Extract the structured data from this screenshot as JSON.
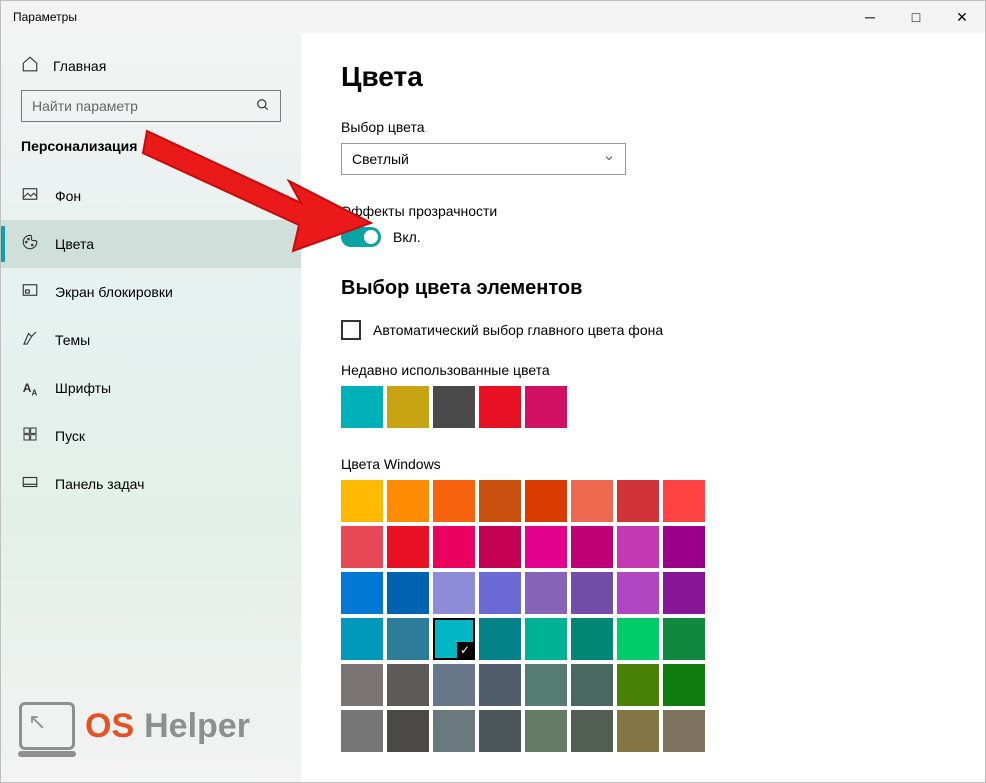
{
  "titlebar": {
    "app_title": "Параметры"
  },
  "sidebar": {
    "home_label": "Главная",
    "search_placeholder": "Найти параметр",
    "category": "Персонализация",
    "items": [
      {
        "label": "Фон"
      },
      {
        "label": "Цвета"
      },
      {
        "label": "Экран блокировки"
      },
      {
        "label": "Темы"
      },
      {
        "label": "Шрифты"
      },
      {
        "label": "Пуск"
      },
      {
        "label": "Панель задач"
      }
    ]
  },
  "page": {
    "title": "Цвета",
    "color_mode_label": "Выбор цвета",
    "color_mode_value": "Светлый",
    "transparency_label": "Эффекты прозрачности",
    "transparency_state": "Вкл.",
    "accent_section_title": "Выбор цвета элементов",
    "auto_checkbox": "Автоматический выбор главного цвета фона",
    "recent_label": "Недавно использованные цвета",
    "recent_colors": [
      "#00b0b9",
      "#c8a415",
      "#4a4a4a",
      "#e81123",
      "#d10f63"
    ],
    "windows_colors_label": "Цвета Windows",
    "selected_index": 26,
    "windows_colors": [
      "#ffb900",
      "#ff8c00",
      "#f7630c",
      "#ca5010",
      "#da3b01",
      "#ef6950",
      "#d13438",
      "#ff4343",
      "#e74856",
      "#e81123",
      "#ea005e",
      "#c30052",
      "#e3008c",
      "#bf0077",
      "#c239b3",
      "#9a0089",
      "#0078d4",
      "#0063b1",
      "#8e8cd8",
      "#6b69d6",
      "#8764b8",
      "#744da9",
      "#b146c2",
      "#881798",
      "#0099bc",
      "#2d7d9a",
      "#00b7c3",
      "#038387",
      "#00b294",
      "#018574",
      "#00cc6a",
      "#10893e",
      "#7a7574",
      "#5d5a58",
      "#68768a",
      "#515c6b",
      "#567c73",
      "#486860",
      "#498205",
      "#107c10",
      "#767676",
      "#4c4a48",
      "#69797e",
      "#4a5459",
      "#647c64",
      "#525e54",
      "#847545",
      "#7e735f"
    ]
  },
  "watermark": {
    "os": "OS",
    "helper": "Helper"
  }
}
